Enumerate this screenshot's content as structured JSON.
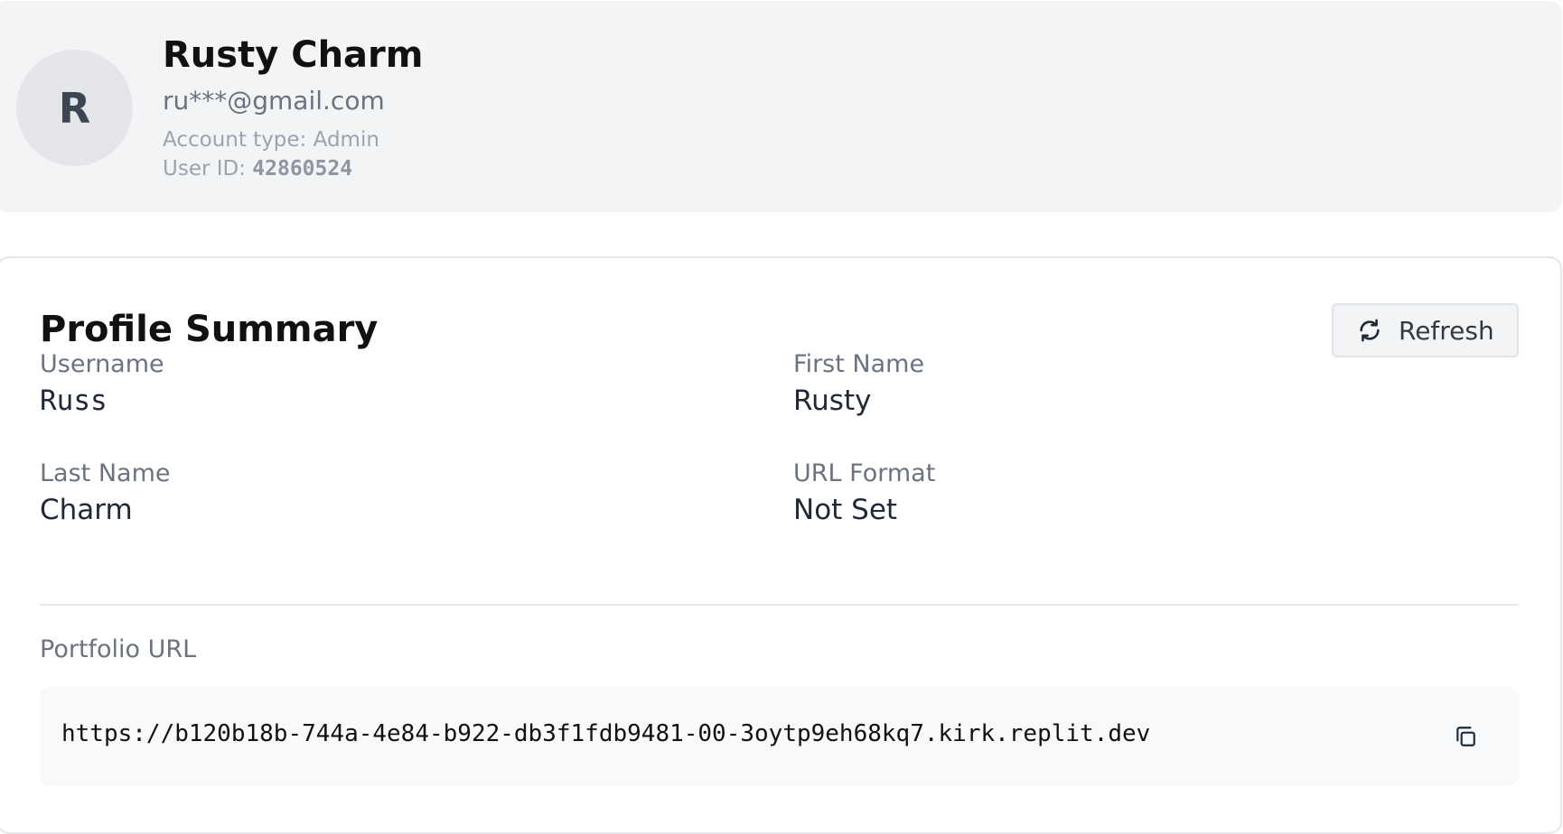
{
  "profile": {
    "avatar_initial": "R",
    "display_name": "Rusty Charm",
    "email": "ru***@gmail.com",
    "account_type_label": "Account type:",
    "account_type": "Admin",
    "user_id_label": "User ID:",
    "user_id": "42860524"
  },
  "summary": {
    "title": "Profile Summary",
    "refresh_label": "Refresh",
    "refresh_icon": "refresh-icon",
    "fields": [
      {
        "label": "Username",
        "value": "Russ"
      },
      {
        "label": "First Name",
        "value": "Rusty"
      },
      {
        "label": "Last Name",
        "value": "Charm"
      },
      {
        "label": "URL Format",
        "value": "Not Set"
      }
    ],
    "portfolio_label": "Portfolio URL",
    "portfolio_url": "https://b120b18b-744a-4e84-b922-db3f1fdb9481-00-3oytp9eh68kq7.kirk.replit.dev",
    "copy_icon": "copy-icon"
  },
  "colors": {
    "header_bg": "#f3f4f6",
    "avatar_bg": "#e4e6ea",
    "muted_text": "#6b7280",
    "url_box_bg": "#f8f9fb"
  }
}
